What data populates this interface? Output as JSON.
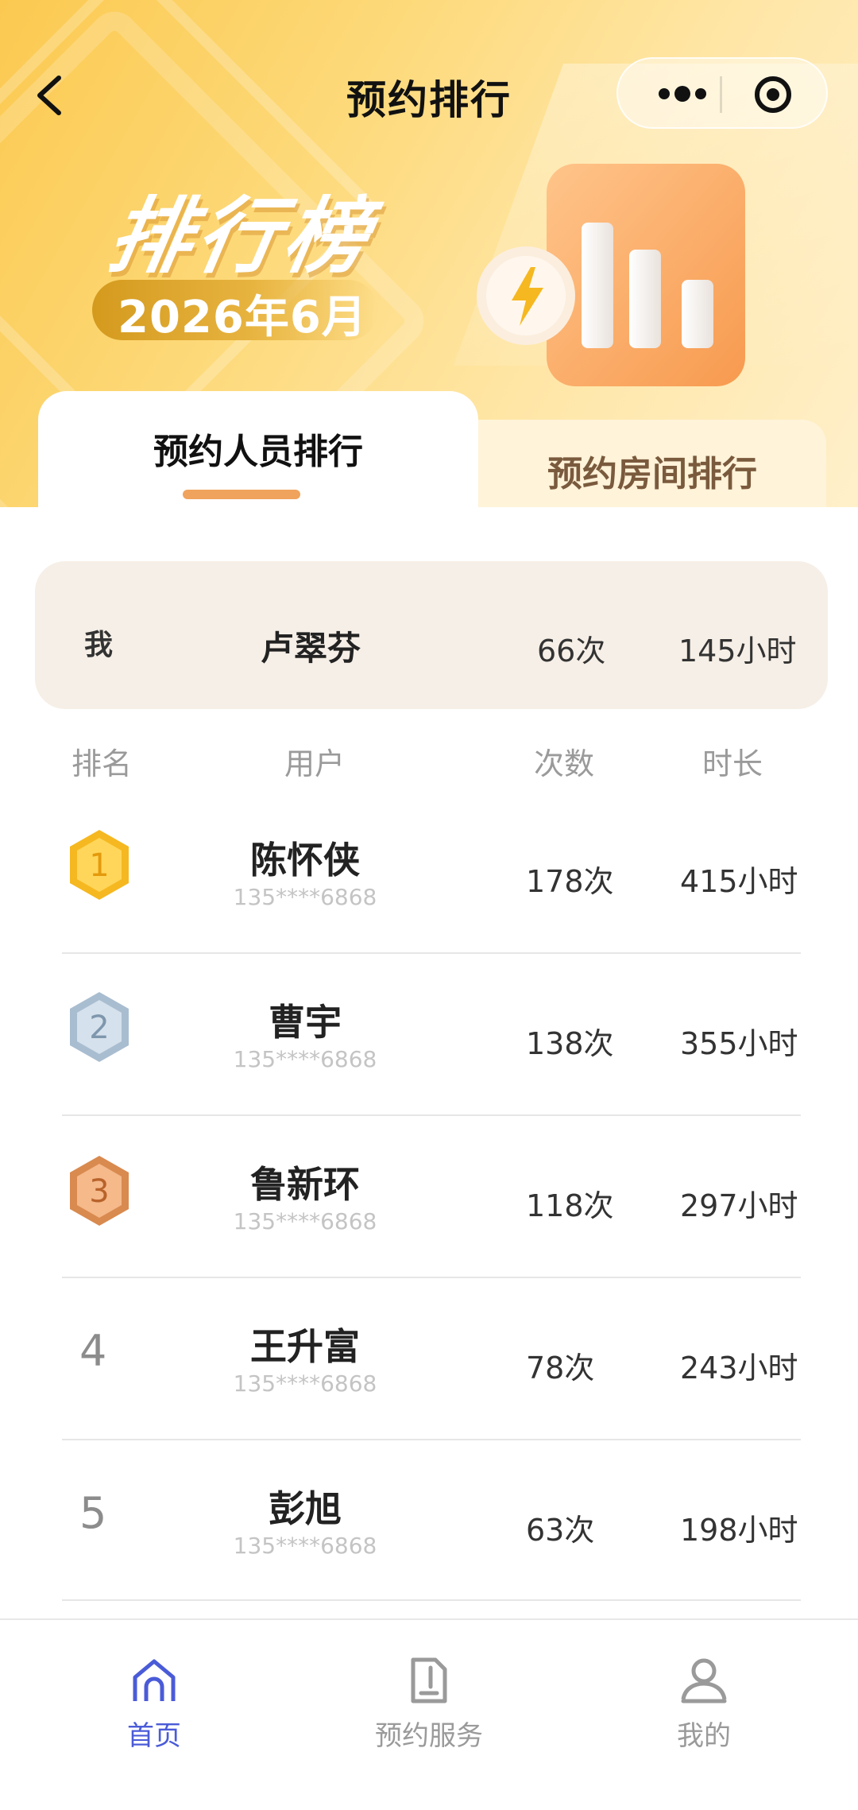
{
  "nav": {
    "title": "预约排行"
  },
  "banner": {
    "title": "排行榜",
    "month": "2026年6月"
  },
  "tabs": [
    {
      "label": "预约人员排行",
      "active": true
    },
    {
      "label": "预约房间排行",
      "active": false
    }
  ],
  "me": {
    "label": "我",
    "name": "卢翠芬",
    "count": "66次",
    "time": "145小时"
  },
  "table": {
    "headers": {
      "rank": "排名",
      "user": "用户",
      "count": "次数",
      "time": "时长"
    },
    "rows": [
      {
        "rank": "1",
        "name": "陈怀侠",
        "phone": "135****6868",
        "count": "178次",
        "time": "415小时",
        "medal": "gold"
      },
      {
        "rank": "2",
        "name": "曹宇",
        "phone": "135****6868",
        "count": "138次",
        "time": "355小时",
        "medal": "silver"
      },
      {
        "rank": "3",
        "name": "鲁新环",
        "phone": "135****6868",
        "count": "118次",
        "time": "297小时",
        "medal": "bronze"
      },
      {
        "rank": "4",
        "name": "王升富",
        "phone": "135****6868",
        "count": "78次",
        "time": "243小时"
      },
      {
        "rank": "5",
        "name": "彭旭",
        "phone": "135****6868",
        "count": "63次",
        "time": "198小时"
      }
    ]
  },
  "tabbar": [
    {
      "label": "首页",
      "icon": "home-icon",
      "active": true
    },
    {
      "label": "预约服务",
      "icon": "document-icon",
      "active": false
    },
    {
      "label": "我的",
      "icon": "user-icon",
      "active": false
    }
  ],
  "colors": {
    "accent": "#f0a35c",
    "active_tab": "#4a5bd8",
    "inactive_tab": "#9a9a9a",
    "gold": "#f6b820",
    "silver": "#a9bdd0",
    "bronze": "#d98a4f"
  }
}
